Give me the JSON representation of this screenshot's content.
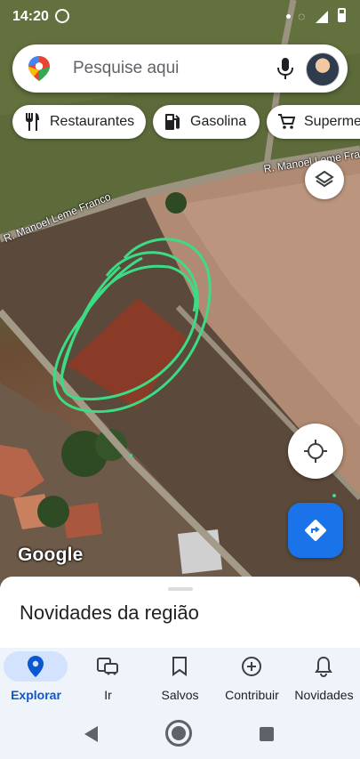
{
  "status_bar": {
    "time": "14:20"
  },
  "search": {
    "placeholder": "Pesquise aqui"
  },
  "chips": [
    {
      "label": "Restaurantes",
      "icon": "fork-knife-icon"
    },
    {
      "label": "Gasolina",
      "icon": "gas-station-icon"
    },
    {
      "label": "Supermer",
      "icon": "shopping-cart-icon"
    }
  ],
  "map": {
    "road_labels": [
      "R. Manoel Leme Franco",
      "R. Manoel Leme Franco"
    ],
    "logo": "Google",
    "drawing_color": "#3ddc84"
  },
  "sheet": {
    "title": "Novidades da região"
  },
  "nav": {
    "items": [
      {
        "label": "Explorar",
        "icon": "location-pin-icon",
        "active": true
      },
      {
        "label": "Ir",
        "icon": "commute-icon",
        "active": false
      },
      {
        "label": "Salvos",
        "icon": "bookmark-icon",
        "active": false
      },
      {
        "label": "Contribuir",
        "icon": "add-circle-icon",
        "active": false
      },
      {
        "label": "Novidades",
        "icon": "bell-icon",
        "active": false
      }
    ]
  },
  "colors": {
    "accent": "#1a73e8",
    "active_nav": "#0b57d0",
    "active_pill": "#d3e3fd"
  }
}
